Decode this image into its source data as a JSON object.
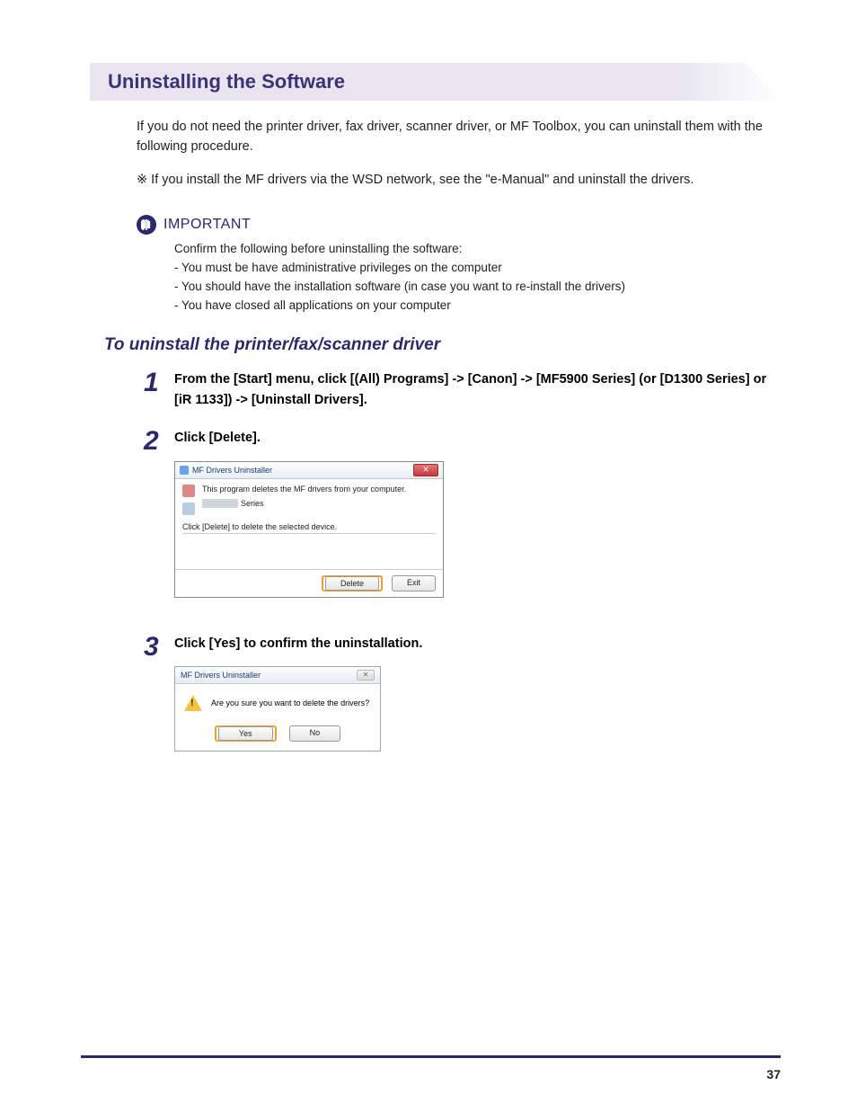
{
  "section_heading": "Uninstalling the Software",
  "intro": "If you do not need the printer driver, fax driver, scanner driver, or MF Toolbox, you can uninstall them with the following procedure.",
  "star_note": "※ If you install the MF drivers via the WSD network, see the \"e-Manual\" and uninstall the drivers.",
  "important": {
    "label": "IMPORTANT",
    "lines": [
      "Confirm the following before uninstalling the software:",
      "- You must be have administrative privileges on the computer",
      "- You should have the installation software (in case you want to re-install the drivers)",
      "- You have closed all applications on your computer"
    ]
  },
  "subheading": "To uninstall the printer/fax/scanner driver",
  "steps": {
    "1": {
      "num": "1",
      "text": "From the [Start] menu, click [(All) Programs] -> [Canon] -> [MF5900 Series] (or [D1300 Series] or [iR 1133]) -> [Uninstall Drivers]."
    },
    "2": {
      "num": "2",
      "text": "Click [Delete]."
    },
    "3": {
      "num": "3",
      "text": "Click [Yes] to confirm the uninstallation."
    }
  },
  "dialog1": {
    "title": "MF Drivers Uninstaller",
    "msg": "This program deletes the MF drivers from your computer.",
    "series_suffix": "Series",
    "click_msg": "Click [Delete] to delete the selected device.",
    "delete_btn": "Delete",
    "exit_btn": "Exit"
  },
  "dialog2": {
    "title": "MF Drivers Uninstaller",
    "msg": "Are you sure you want to delete the drivers?",
    "yes_btn": "Yes",
    "no_btn": "No"
  },
  "page_number": "37"
}
